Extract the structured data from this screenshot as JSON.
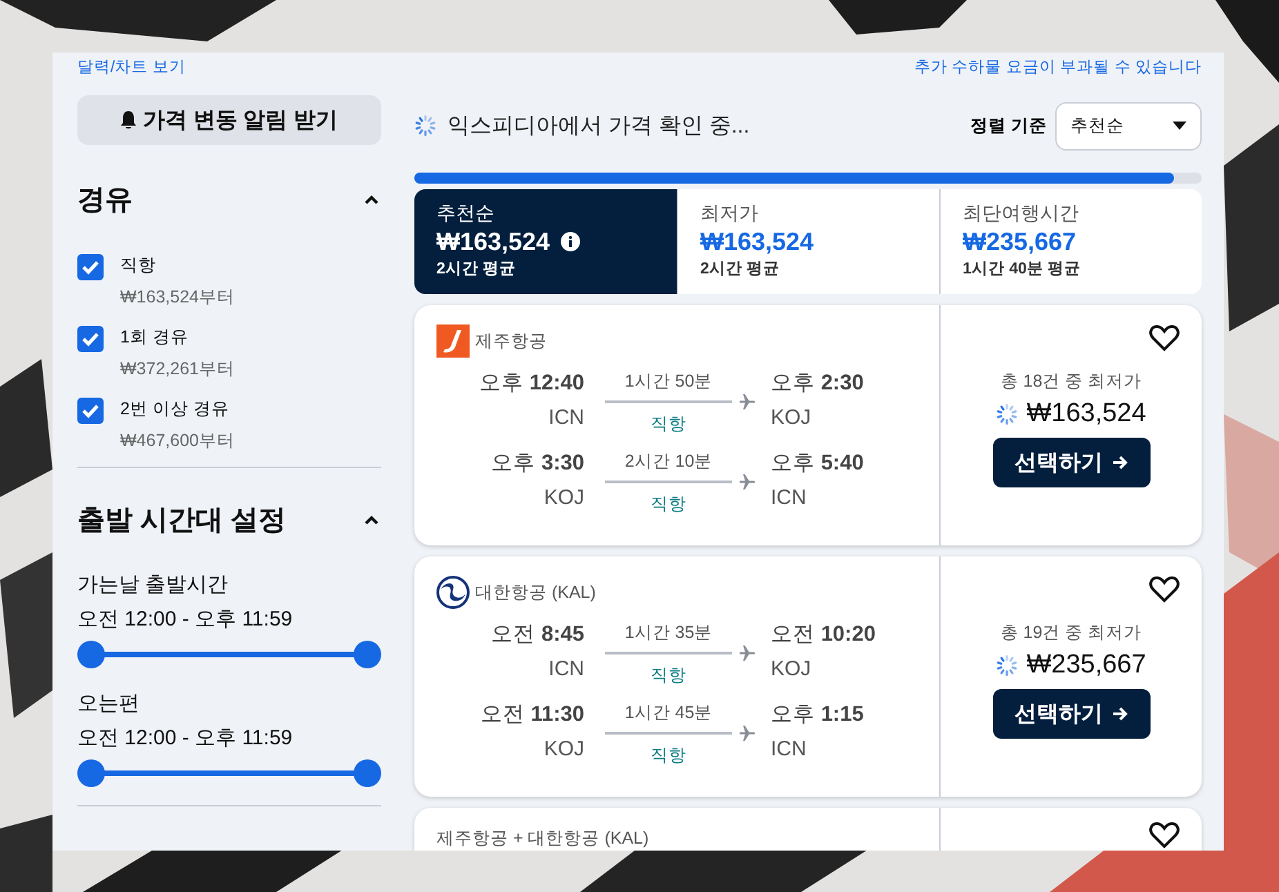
{
  "links": {
    "calendar": "달력/차트 보기",
    "baggage_notice": "추가 수하물 요금이 부과될 수 있습니다"
  },
  "sidebar": {
    "alert_button": "가격 변동 알림 받기",
    "stops": {
      "title": "경유",
      "expanded": true,
      "options": [
        {
          "label": "직항",
          "price": "₩163,524부터",
          "checked": true
        },
        {
          "label": "1회 경유",
          "price": "₩372,261부터",
          "checked": true
        },
        {
          "label": "2번 이상 경유",
          "price": "₩467,600부터",
          "checked": true
        }
      ]
    },
    "times": {
      "title": "출발 시간대 설정",
      "expanded": true,
      "sliders": [
        {
          "label": "가는날 출발시간",
          "range": "오전 12:00 - 오후 11:59",
          "thumbs": [
            {
              "level": 0
            },
            {
              "level": 1
            }
          ]
        },
        {
          "label": "오는편",
          "range": "오전 12:00 - 오후 11:59",
          "thumbs": [
            {
              "level": 0
            },
            {
              "level": 1
            }
          ]
        }
      ]
    }
  },
  "status": {
    "text": "익스피디아에서 가격 확인 중...",
    "progress": {
      "level": 0.965
    }
  },
  "sort": {
    "label": "정렬 기준",
    "value": "추천순"
  },
  "sort_tabs": [
    {
      "label": "추천순",
      "price": "₩163,524",
      "subtitle": "2시간 평균",
      "selected": true,
      "info": true
    },
    {
      "label": "최저가",
      "price": "₩163,524",
      "subtitle": "2시간 평균",
      "selected": false,
      "info": false
    },
    {
      "label": "최단여행시간",
      "price": "₩235,667",
      "subtitle": "1시간 40분 평균",
      "selected": false,
      "info": false
    }
  ],
  "flights": [
    {
      "airline": "제주항공",
      "kind": "jeju",
      "count_text": "총 18건 중 최저가",
      "price": "₩163,524",
      "button": "선택하기",
      "legs": [
        {
          "depart": "오후 **12:40**",
          "from": "ICN",
          "duration": "1시간 50분",
          "stops": "직항",
          "arrive": "오후 **2:30**",
          "to": "KOJ"
        },
        {
          "depart": "오후 **3:30**",
          "from": "KOJ",
          "duration": "2시간 10분",
          "stops": "직항",
          "arrive": "오후 **5:40**",
          "to": "ICN"
        }
      ]
    },
    {
      "airline": "대한항공 (KAL)",
      "kind": "kal",
      "count_text": "총 19건 중 최저가",
      "price": "₩235,667",
      "button": "선택하기",
      "legs": [
        {
          "depart": "오전 **8:45**",
          "from": "ICN",
          "duration": "1시간 35분",
          "stops": "직항",
          "arrive": "오전 **10:20**",
          "to": "KOJ"
        },
        {
          "depart": "오전 **11:30**",
          "from": "KOJ",
          "duration": "1시간 45분",
          "stops": "직항",
          "arrive": "오후 **1:15**",
          "to": "ICN"
        }
      ]
    },
    {
      "airline": "제주항공 + 대한항공 (KAL)",
      "kind": "partial"
    }
  ]
}
